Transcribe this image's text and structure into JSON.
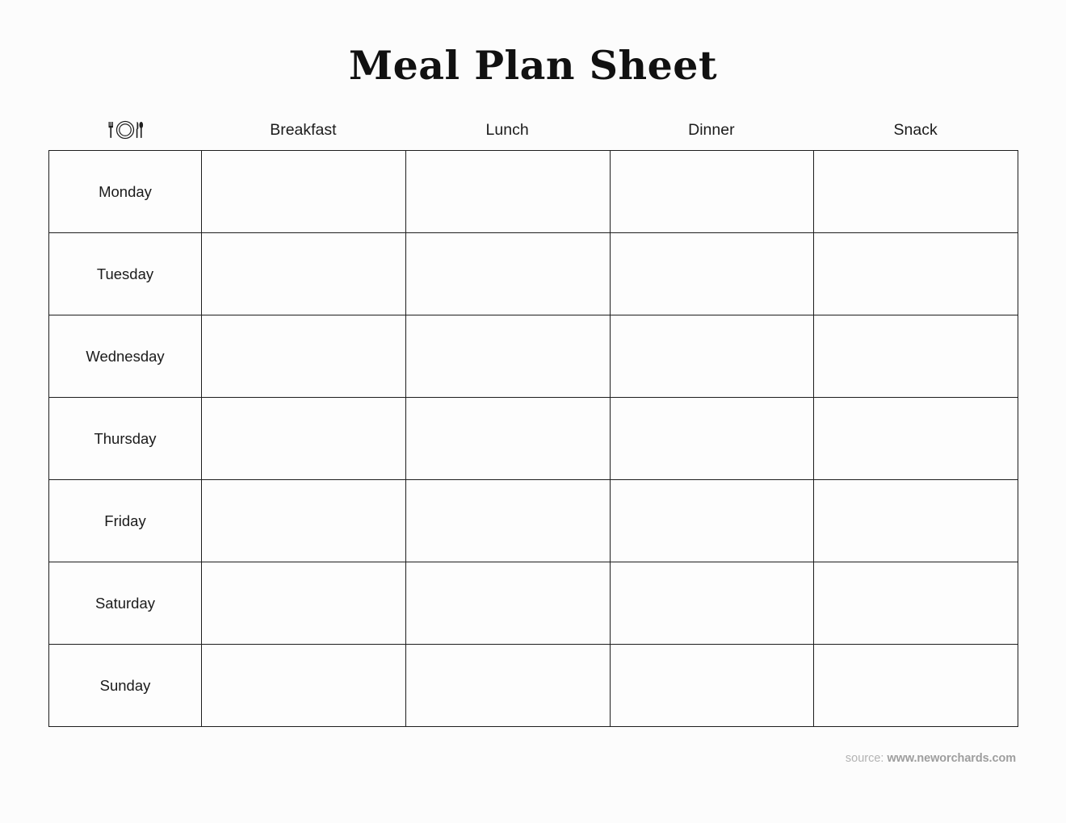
{
  "page": {
    "title": "Meal Plan Sheet",
    "background_color": "#fcfcfc",
    "text_color": "#1a1a1a",
    "border_color": "#1d1d1d"
  },
  "table": {
    "corner_icon_name": "place-setting-icon",
    "column_headers": [
      {
        "label": "Breakfast"
      },
      {
        "label": "Lunch"
      },
      {
        "label": "Dinner"
      },
      {
        "label": "Snack"
      }
    ],
    "rows": [
      {
        "day": "Monday",
        "breakfast": "",
        "lunch": "",
        "dinner": "",
        "snack": ""
      },
      {
        "day": "Tuesday",
        "breakfast": "",
        "lunch": "",
        "dinner": "",
        "snack": ""
      },
      {
        "day": "Wednesday",
        "breakfast": "",
        "lunch": "",
        "dinner": "",
        "snack": ""
      },
      {
        "day": "Thursday",
        "breakfast": "",
        "lunch": "",
        "dinner": "",
        "snack": ""
      },
      {
        "day": "Friday",
        "breakfast": "",
        "lunch": "",
        "dinner": "",
        "snack": ""
      },
      {
        "day": "Saturday",
        "breakfast": "",
        "lunch": "",
        "dinner": "",
        "snack": ""
      },
      {
        "day": "Sunday",
        "breakfast": "",
        "lunch": "",
        "dinner": "",
        "snack": ""
      }
    ]
  },
  "footer": {
    "source_prefix": "source:",
    "source_url": "www.neworchards.com",
    "source_color": "#b3b3b3",
    "url_color": "#9e9e9e"
  }
}
